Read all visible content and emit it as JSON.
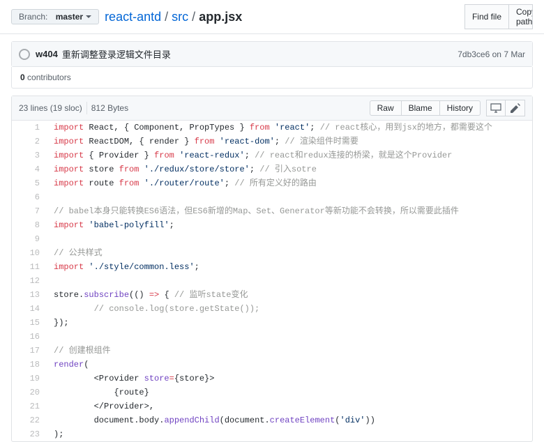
{
  "branch": {
    "label": "Branch:",
    "name": "master"
  },
  "breadcrumb": {
    "repo": "react-antd",
    "dir": "src",
    "file": "app.jsx",
    "sep": "/"
  },
  "topbuttons": {
    "findfile": "Find file",
    "copy": "Copy path"
  },
  "commit": {
    "author": "w404",
    "message": "重新调整登录逻辑文件目录",
    "sha": "7db3ce6",
    "on": "on",
    "date": "7 Mar"
  },
  "contributors": {
    "count": "0",
    "label": "contributors"
  },
  "fileinfo": {
    "lines": "23 lines (19 sloc)",
    "bytes": "812 Bytes"
  },
  "actions": {
    "raw": "Raw",
    "blame": "Blame",
    "history": "History"
  },
  "code": {
    "l1": {
      "a": "import",
      "b": " React, { Component, PropTypes } ",
      "c": "from",
      "d": " ",
      "e": "'react'",
      "f": "; ",
      "g": "// react核心，用到jsx的地方，都需要这个"
    },
    "l2": {
      "a": "import",
      "b": " ReactDOM, { render } ",
      "c": "from",
      "d": " ",
      "e": "'react-dom'",
      "f": "; ",
      "g": "// 渲染组件时需要"
    },
    "l3": {
      "a": "import",
      "b": " { Provider } ",
      "c": "from",
      "d": " ",
      "e": "'react-redux'",
      "f": "; ",
      "g": "// react和redux连接的桥梁，就是这个Provider"
    },
    "l4": {
      "a": "import",
      "b": " store ",
      "c": "from",
      "d": " ",
      "e": "'./redux/store/store'",
      "f": "; ",
      "g": "// 引入sotre"
    },
    "l5": {
      "a": "import",
      "b": " route ",
      "c": "from",
      "d": " ",
      "e": "'./router/route'",
      "f": "; ",
      "g": "// 所有定义好的路由"
    },
    "l7": "// babel本身只能转换ES6语法，但ES6新增的Map、Set、Generator等新功能不会转换，所以需要此插件",
    "l8": {
      "a": "import",
      "b": " ",
      "e": "'babel-polyfill'",
      "f": ";"
    },
    "l10": "// 公共样式",
    "l11": {
      "a": "import",
      "b": " ",
      "e": "'./style/common.less'",
      "f": ";"
    },
    "l13": {
      "a": "store.",
      "b": "subscribe",
      "c": "(() ",
      "d": "=>",
      "e": " { ",
      "f": "// 监听state变化"
    },
    "l14": "        // console.log(store.getState());",
    "l15": "});",
    "l17": "// 创建根组件",
    "l18": {
      "a": "render",
      "b": "("
    },
    "l19": {
      "a": "        <Provider ",
      "b": "store",
      "c": "=",
      "d": "{store}",
      "e": ">"
    },
    "l20": "            {route}",
    "l21": "        </Provider>,",
    "l22": {
      "a": "        ",
      "b": "document",
      "c": ".",
      "d": "body",
      "e": ".",
      "f": "appendChild",
      "g": "(",
      "h": "document",
      "i": ".",
      "j": "createElement",
      "k": "(",
      "l": "'div'",
      "m": "))"
    },
    "l23": ");"
  }
}
